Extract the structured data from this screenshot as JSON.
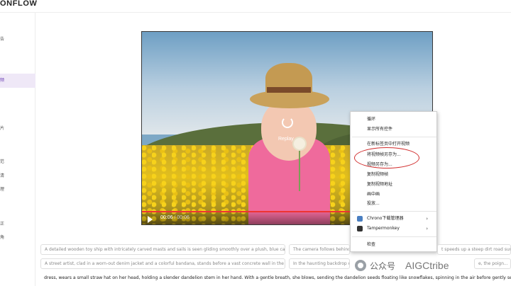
{
  "app": {
    "logo_text": "ONFLOW"
  },
  "sidebar": {
    "items": [
      {
        "label": "告"
      },
      {
        "label": ""
      },
      {
        "label": "频"
      },
      {
        "label": ""
      },
      {
        "label": "片"
      },
      {
        "label": "范"
      },
      {
        "label": "清"
      },
      {
        "label": "理"
      },
      {
        "label": "正"
      },
      {
        "label": "角"
      }
    ]
  },
  "video": {
    "overlay_label": "Replay",
    "current_time": "00:06",
    "separator": " / ",
    "duration": "00:06",
    "progress_fraction": 1.0
  },
  "context_menu": {
    "items": [
      {
        "label": "循环"
      },
      {
        "label": "显示所有控件"
      },
      {
        "label": "在新标签页中打开视频"
      },
      {
        "label": "将视频帧另存为..."
      },
      {
        "label": "视频另存为..."
      },
      {
        "label": "复制视频帧"
      },
      {
        "label": "复制视频地址"
      },
      {
        "label": "画中画"
      },
      {
        "label": "投放..."
      },
      {
        "label": "Chrono下载管理器"
      },
      {
        "label": "Tampermonkey"
      },
      {
        "label": "检查"
      }
    ],
    "submenu_arrow": "›"
  },
  "prompts": {
    "cards": [
      {
        "text": "A detailed wooden toy ship with intricately carved masts and sails is seen gliding smoothly over a plush, blue car..."
      },
      {
        "text": "The camera follows behind a ..."
      },
      {
        "text": "t speeds up a steep dirt road surrou..."
      },
      {
        "text": "A street artist, clad in a worn-out denim jacket and a colorful bandana, stands before a vast concrete wall in the h..."
      },
      {
        "text": "In the haunting backdrop of ..."
      },
      {
        "text": "e, the poign..."
      }
    ],
    "bottom_text": "dress, wears a small straw hat on her head, holding a slender dandelion stem in her hand. With a gentle breath, she blows, sending the dandelion seeds floating like snowflakes, spinning in the air before gently settling,"
  },
  "watermark": {
    "channel": "公众号",
    "brand": "AIGCtribe"
  }
}
